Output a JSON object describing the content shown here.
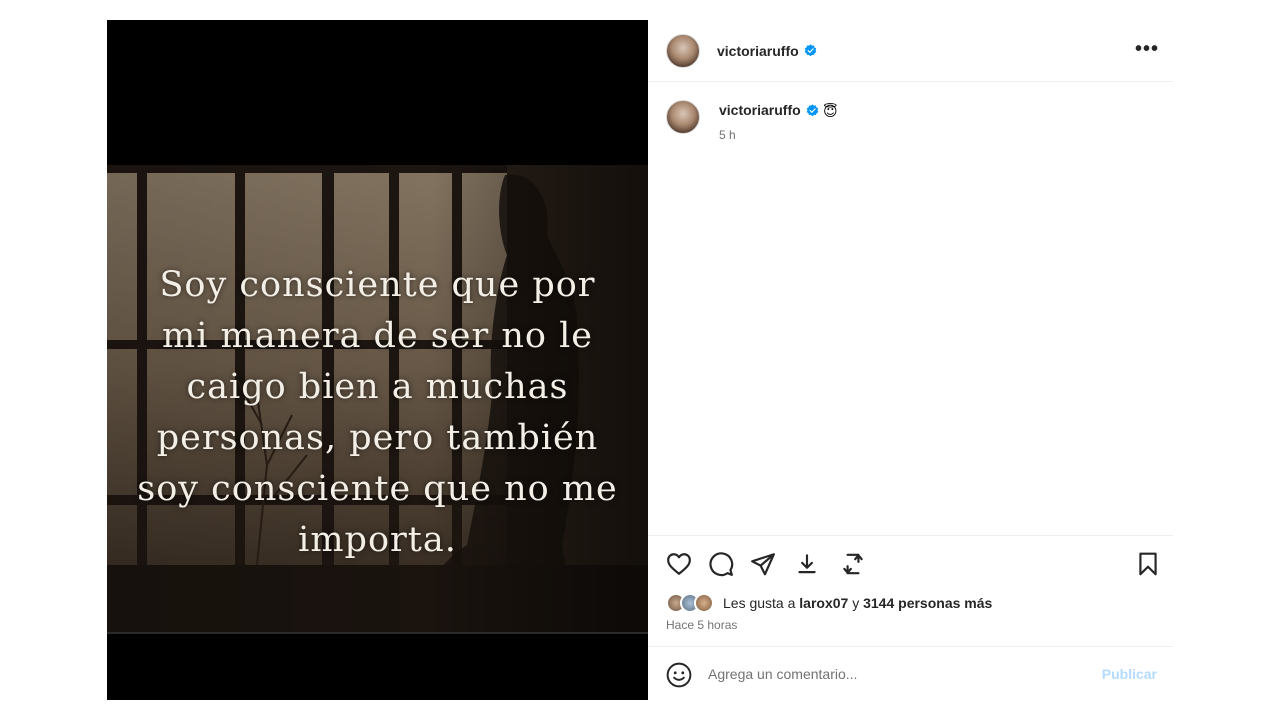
{
  "post": {
    "image_quote_lines": [
      "Soy consciente que por",
      "mi manera de ser no le",
      "caigo bien a muchas",
      "personas, pero también",
      "soy consciente que no me",
      "importa."
    ]
  },
  "header": {
    "username": "victoriaruffo",
    "verified_icon": "verified-badge-icon",
    "more_icon": "more-options-icon",
    "more_glyph": "•••"
  },
  "caption": {
    "username": "victoriaruffo",
    "emoji": "😇",
    "time": "5 h"
  },
  "actions": {
    "like_icon": "heart-icon",
    "comment_icon": "comment-icon",
    "share_icon": "share-icon",
    "download_icon": "download-icon",
    "repost_icon": "repost-icon",
    "save_icon": "bookmark-icon"
  },
  "likes": {
    "prefix": "Les gusta a ",
    "user": "larox07",
    "connector": " y ",
    "others": "3144 personas más"
  },
  "time_ago": "Hace 5 horas",
  "comment": {
    "placeholder": "Agrega un comentario...",
    "publish_label": "Publicar"
  },
  "colors": {
    "verified": "#0095f6",
    "publish_disabled": "#b3dbff",
    "secondary_text": "#737373"
  }
}
